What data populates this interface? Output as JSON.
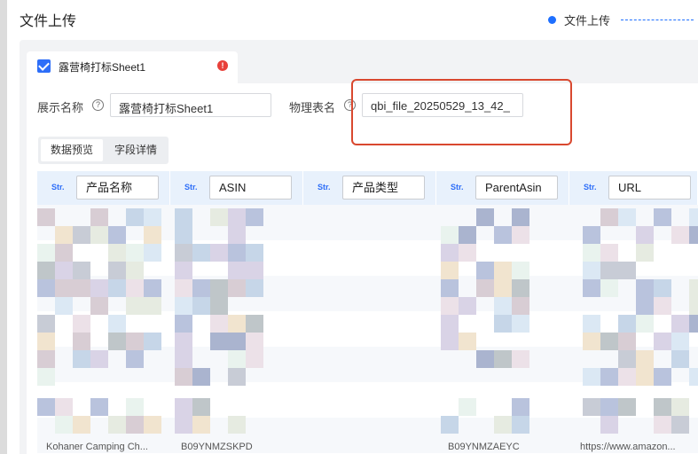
{
  "header": {
    "title": "文件上传",
    "step_label": "文件上传",
    "accent_color": "#1e6fff"
  },
  "sheet_tab": {
    "name": "露营椅打标Sheet1",
    "warning_icon": "exclamation-icon"
  },
  "form": {
    "display_name_label": "展示名称",
    "display_name_value": "露营椅打标Sheet1",
    "physical_name_label": "物理表名",
    "physical_name_value": "qbi_file_20250529_13_42_"
  },
  "tabs": {
    "preview": "数据预览",
    "fields": "字段详情"
  },
  "columns": [
    {
      "type": "Str.",
      "name": "产品名称"
    },
    {
      "type": "Str.",
      "name": "ASIN"
    },
    {
      "type": "Str.",
      "name": "产品类型"
    },
    {
      "type": "Str.",
      "name": "ParentAsin"
    },
    {
      "type": "Str.",
      "name": "URL"
    }
  ],
  "last_row": {
    "c1": "Kohaner Camping Ch...",
    "c2": "B09YNMZSKPD",
    "c4": "B09YNMZAEYC",
    "c5": "https://www.amazon..."
  }
}
